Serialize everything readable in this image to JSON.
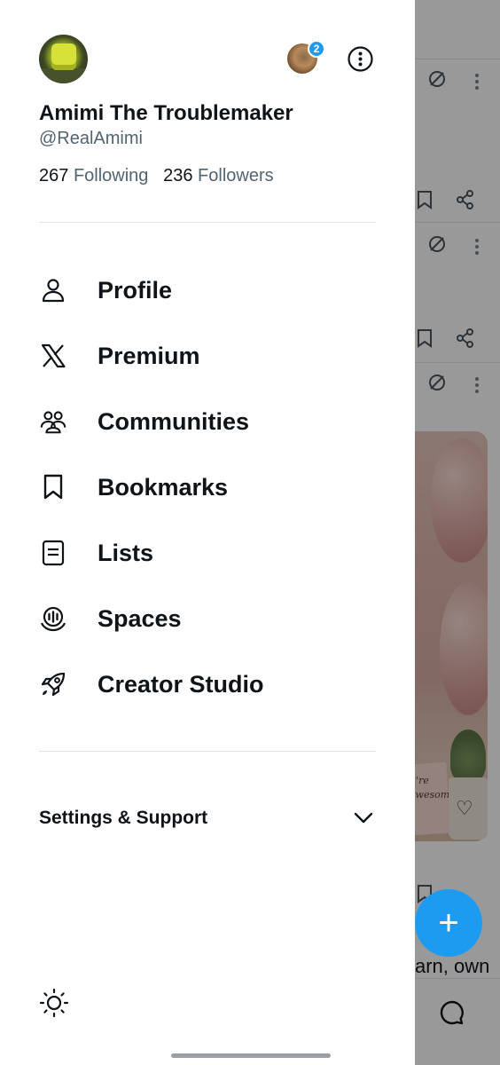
{
  "profile": {
    "display_name": "Amimi The Troublemaker",
    "handle": "@RealAmimi",
    "following_count": "267",
    "following_label": "Following",
    "followers_count": "236",
    "followers_label": "Followers"
  },
  "header": {
    "account_switcher_badge": "2",
    "more_icon": "more-vertical-circle-icon"
  },
  "menu": {
    "items": [
      {
        "label": "Profile",
        "icon": "person-icon"
      },
      {
        "label": "Premium",
        "icon": "x-logo-icon"
      },
      {
        "label": "Communities",
        "icon": "communities-icon"
      },
      {
        "label": "Bookmarks",
        "icon": "bookmark-icon"
      },
      {
        "label": "Lists",
        "icon": "lists-icon"
      },
      {
        "label": "Spaces",
        "icon": "spaces-icon"
      },
      {
        "label": "Creator Studio",
        "icon": "rocket-icon"
      }
    ]
  },
  "settings": {
    "label": "Settings & Support",
    "icon": "chevron-down-icon"
  },
  "footer": {
    "display_icon": "sun-icon"
  },
  "background": {
    "card_text": "u're awesome!",
    "snippet_text": "arn, own",
    "fab_icon": "plus-icon",
    "fab_color": "#1d9bf0",
    "messages_icon": "chat-bubble-icon"
  },
  "colors": {
    "accent": "#1d9bf0",
    "text_primary": "#0f1419",
    "text_secondary": "#536471"
  }
}
